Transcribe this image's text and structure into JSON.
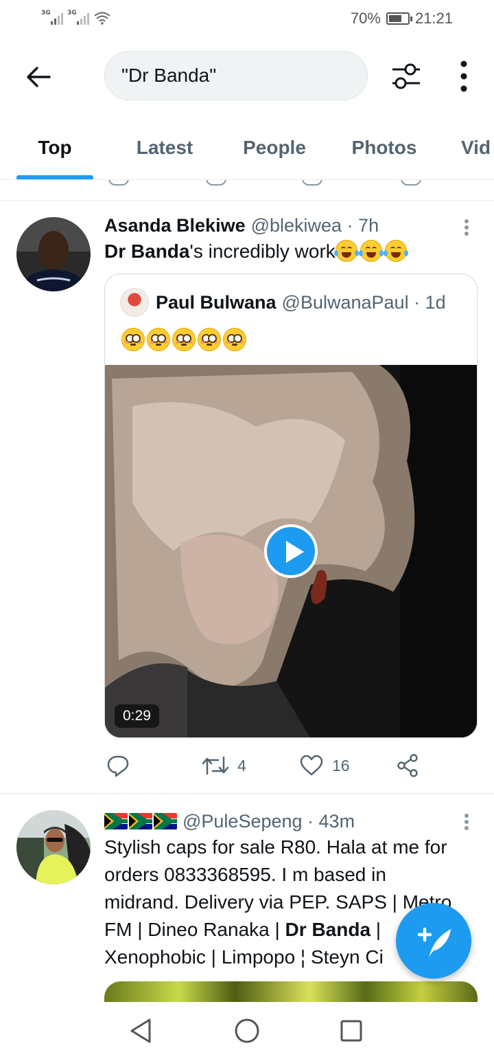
{
  "status_bar": {
    "signal1_label": "3G",
    "signal2_label": "3G",
    "battery_percent": "70%",
    "battery_level": 0.7,
    "time": "21:21"
  },
  "header": {
    "back_icon": "arrow-left-icon",
    "search_query": "\"Dr Banda\"",
    "filter_icon": "sliders-icon",
    "more_icon": "more-vertical-icon"
  },
  "tabs": [
    {
      "label": "Top",
      "active": true
    },
    {
      "label": "Latest",
      "active": false
    },
    {
      "label": "People",
      "active": false
    },
    {
      "label": "Photos",
      "active": false
    },
    {
      "label": "Vid",
      "active": false
    }
  ],
  "tweets": [
    {
      "name": "Asanda Blekiwe",
      "meta": "@blekiwea · 7h",
      "text_bold": "Dr Banda",
      "text_rest": "'s incredibly work",
      "emoji": "😂😂😂",
      "quote": {
        "name": "Paul Bulwana",
        "meta": "@BulwanaPaul · 1d",
        "emoji": "😳😳😳😳😳",
        "video_duration": "0:29"
      },
      "actions": {
        "reply_count": "",
        "retweet_count": "4",
        "like_count": "16"
      }
    },
    {
      "flags": "🇿🇦🇿🇦🇿🇦",
      "meta": "@PuleSepeng · 43m",
      "lines": [
        "Stylish caps for sale R80. Hala at me for",
        "orders 0833368595. I m based in",
        "midrand. Delivery via PEP. SAPS | Metro",
        "FM | Dineo Ranaka | ",
        "Dr Banda",
        " | ",
        "Xenophobic | Limpopo ¦ Steyn Ci"
      ]
    }
  ],
  "fab": {
    "icon": "compose-tweet-icon"
  },
  "colors": {
    "accent": "#1d9bf0",
    "text": "#0f1419",
    "secondary": "#536471"
  }
}
